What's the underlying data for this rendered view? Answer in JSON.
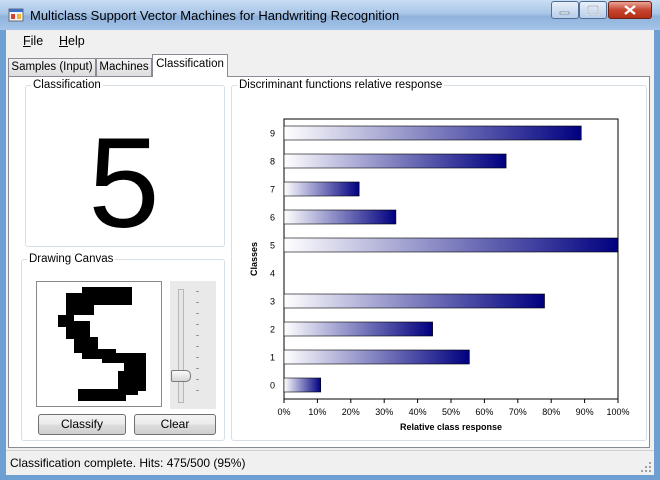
{
  "window": {
    "title": "Multiclass Support Vector Machines for Handwriting Recognition",
    "controls": [
      "minimize",
      "maximize",
      "close"
    ]
  },
  "menu": [
    {
      "label": "File",
      "mnemonic": "F"
    },
    {
      "label": "Help",
      "mnemonic": "H"
    }
  ],
  "tabs": [
    {
      "label": "Samples (Input)",
      "active": false
    },
    {
      "label": "Machines",
      "active": false
    },
    {
      "label": "Classification",
      "active": true
    }
  ],
  "classification": {
    "group_label": "Classification",
    "predicted_digit": "5"
  },
  "drawing": {
    "group_label": "Drawing Canvas",
    "slider_level": 0.2,
    "classify_label": "Classify",
    "clear_label": "Clear"
  },
  "response": {
    "group_label": "Discriminant functions relative response"
  },
  "chart_data": {
    "type": "bar",
    "orientation": "horizontal",
    "categories": [
      "0",
      "1",
      "2",
      "3",
      "4",
      "5",
      "6",
      "7",
      "8",
      "9"
    ],
    "values": [
      0.11,
      0.555,
      0.445,
      0.78,
      0.0,
      1.0,
      0.335,
      0.225,
      0.665,
      0.89
    ],
    "xlabel": "Relative class response",
    "ylabel": "Classes",
    "xlim": [
      0,
      1
    ],
    "x_ticks": [
      "0%",
      "10%",
      "20%",
      "30%",
      "40%",
      "50%",
      "60%",
      "70%",
      "80%",
      "90%",
      "100%"
    ],
    "grid": false,
    "bar_gradient": [
      "#ffffff",
      "#000080"
    ]
  },
  "status": {
    "text": "Classification complete. Hits: 475/500 (95%)"
  }
}
